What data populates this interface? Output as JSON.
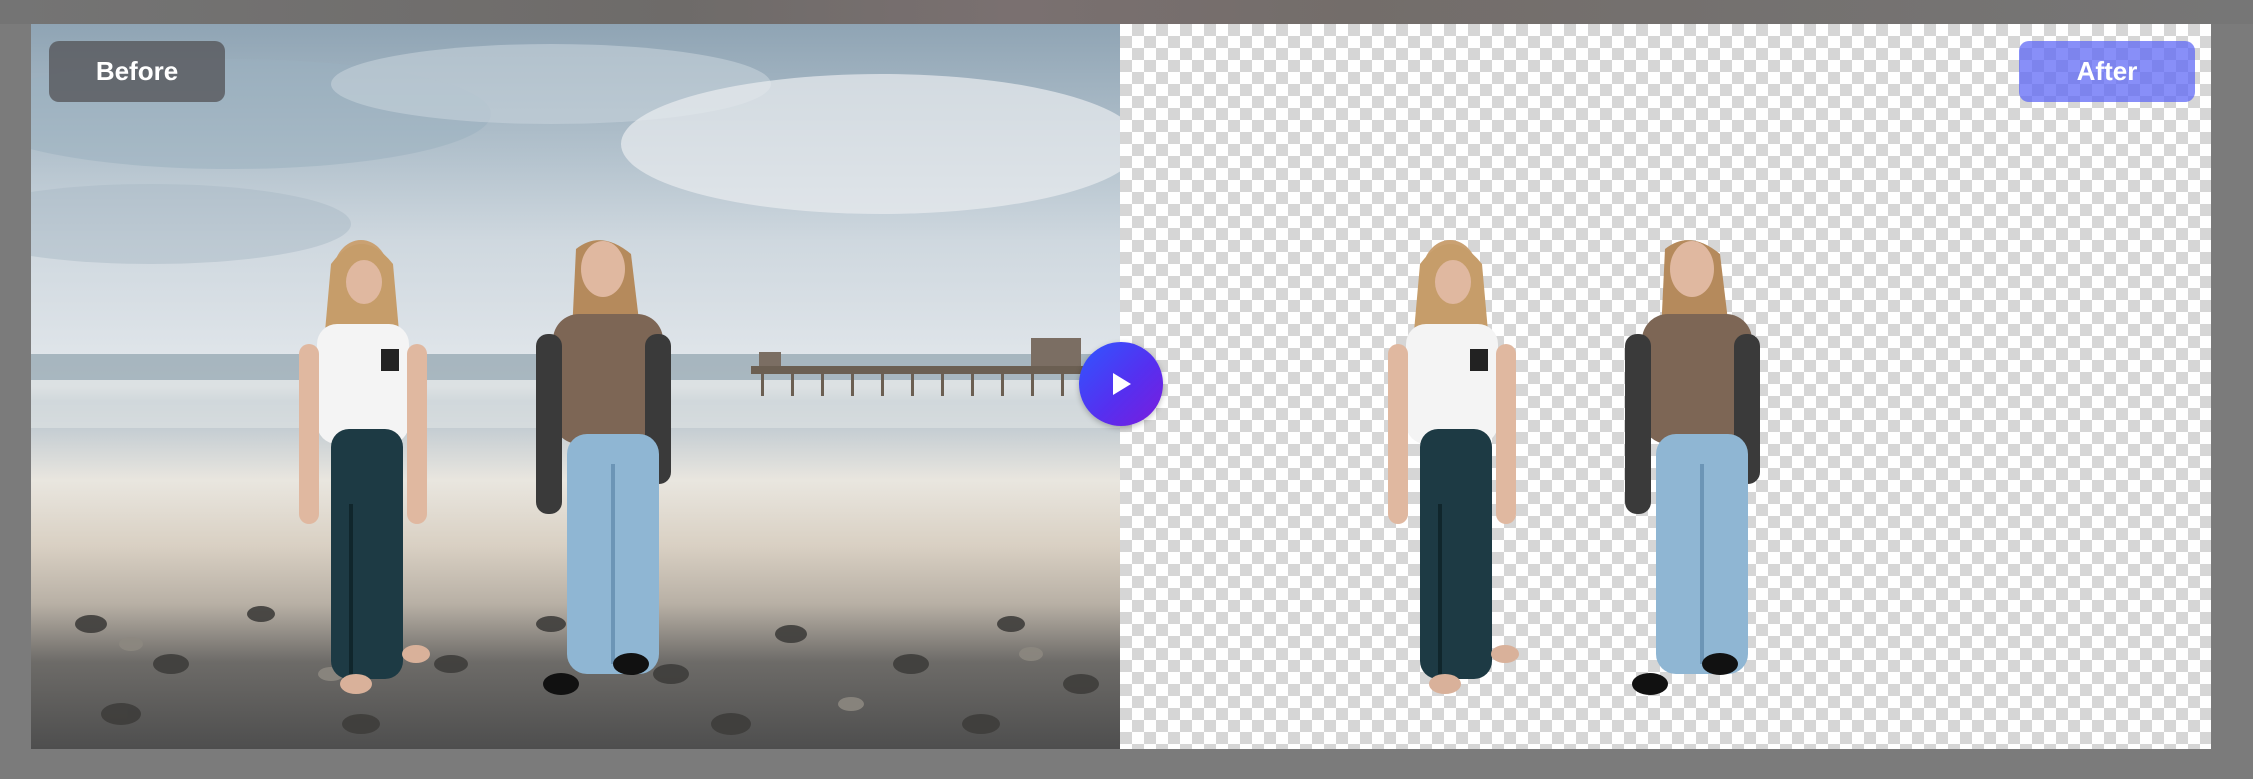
{
  "labels": {
    "before": "Before",
    "after": "After"
  },
  "controls": {
    "compare_icon": "play-icon"
  },
  "colors": {
    "accent_start": "#2f57ff",
    "accent_end": "#7b1cdc",
    "after_tag": "#5a64f5",
    "before_tag": "#555558"
  }
}
